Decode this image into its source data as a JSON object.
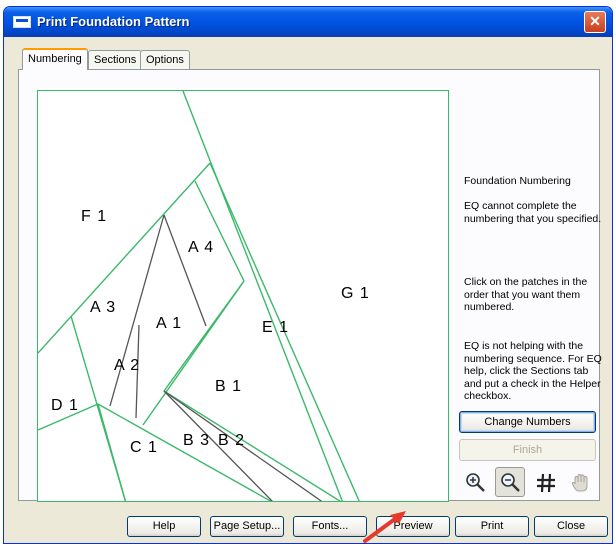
{
  "window": {
    "title": "Print Foundation Pattern"
  },
  "tabs": [
    {
      "label": "Numbering",
      "active": true
    },
    {
      "label": "Sections",
      "active": false
    },
    {
      "label": "Options",
      "active": false
    }
  ],
  "pattern": {
    "patches": [
      "F 1",
      "A 4",
      "A 3",
      "A 1",
      "G 1",
      "E 1",
      "A 2",
      "B 1",
      "D 1",
      "B 3",
      "B 2",
      "C 1"
    ]
  },
  "info": {
    "heading": "Foundation Numbering",
    "warning": "EQ cannot complete the numbering that you specified.",
    "instruction": "Click on the patches in the order that you want them numbered.",
    "help": "EQ is not helping with the numbering sequence. For EQ help, click the Sections tab and put a check in the Helper checkbox."
  },
  "side_buttons": {
    "change_numbers": "Change Numbers",
    "finish": "Finish"
  },
  "tools": [
    "zoom-in-icon",
    "zoom-out-icon",
    "grid-icon",
    "hand-icon"
  ],
  "footer_buttons": {
    "help": "Help",
    "page_setup": "Page Setup...",
    "fonts": "Fonts...",
    "preview": "Preview",
    "print": "Print",
    "close": "Close"
  },
  "colors": {
    "titlebar": "#0054e3",
    "seam_line": "#3bb96a",
    "tab_highlight": "#ff9a00",
    "annotation_arrow": "#e53b2c"
  }
}
